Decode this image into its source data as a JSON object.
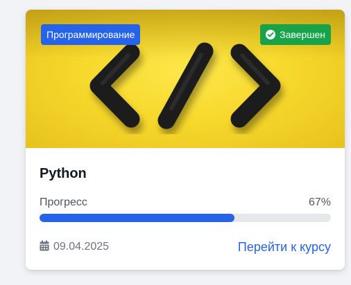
{
  "course": {
    "category": "Программирование",
    "status": "Завершен",
    "status_icon": "check-circle-icon",
    "title": "Python",
    "progress_label": "Прогресс",
    "progress_text": "67%",
    "progress_value": 0.67,
    "date": "09.04.2025",
    "date_icon": "calendar-icon",
    "link_label": "Перейти к курсу"
  },
  "colors": {
    "accent": "#2563eb",
    "success": "#16a34a",
    "cover_background": "#f7d82c"
  }
}
